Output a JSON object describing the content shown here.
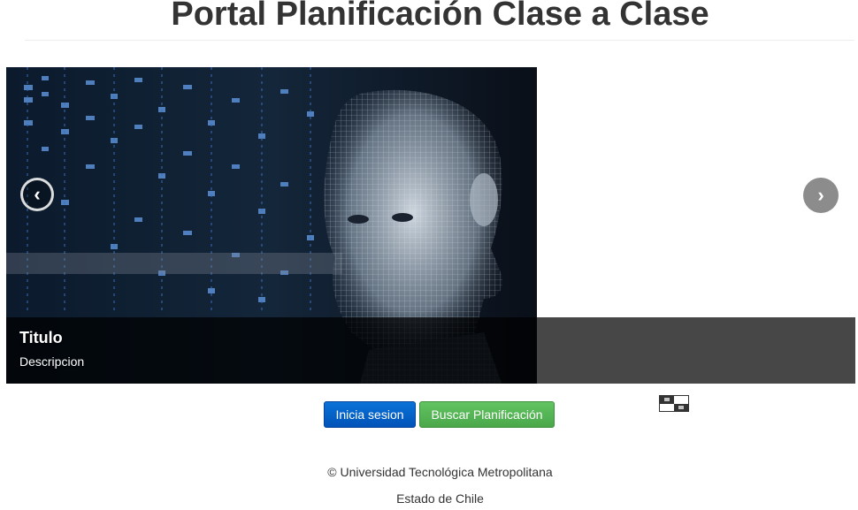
{
  "header": {
    "title": "Portal Planificación Clase a Clase"
  },
  "carousel": {
    "slide": {
      "title": "Titulo",
      "description": "Descripcion",
      "image_subject": "wireframe-digital-head"
    },
    "prev_icon": "chevron-left-icon",
    "next_icon": "chevron-right-icon",
    "prev_glyph": "‹",
    "next_glyph": "›"
  },
  "actions": {
    "login_label": "Inicia sesion",
    "search_label": "Buscar Planificación"
  },
  "footer": {
    "copyright": "© Universidad Tecnológica Metropolitana",
    "state": "Estado de Chile"
  },
  "colors": {
    "primary": "#0a72d8",
    "success": "#5cb85c",
    "caption_band": "#000000",
    "text": "#333333"
  }
}
